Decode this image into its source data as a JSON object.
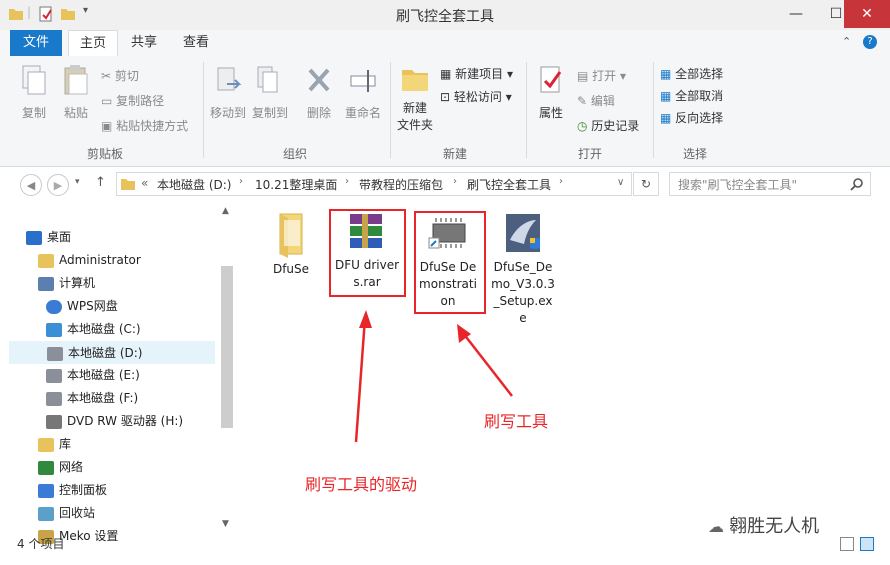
{
  "window": {
    "title": "刷飞控全套工具",
    "minimize": "—",
    "maximize": "☐",
    "close": "✕"
  },
  "tabs": [
    {
      "label": "文件"
    },
    {
      "label": "主页"
    },
    {
      "label": "共享"
    },
    {
      "label": "查看"
    }
  ],
  "ribbon": {
    "clipboard": {
      "group_label": "剪贴板",
      "copy": "复制",
      "paste": "粘贴",
      "cut": "剪切",
      "copy_path": "复制路径",
      "paste_shortcut": "粘贴快捷方式"
    },
    "organize": {
      "group_label": "组织",
      "move_to": "移动到",
      "copy_to": "复制到",
      "delete": "删除",
      "rename": "重命名"
    },
    "new": {
      "group_label": "新建",
      "new_folder_line1": "新建",
      "new_folder_line2": "文件夹",
      "new_item": "新建项目",
      "easy_access": "轻松访问"
    },
    "open": {
      "group_label": "打开",
      "properties": "属性",
      "open": "打开",
      "edit": "编辑",
      "history": "历史记录"
    },
    "select": {
      "group_label": "选择",
      "select_all": "全部选择",
      "select_none": "全部取消",
      "invert": "反向选择"
    }
  },
  "address": {
    "prefix": "«",
    "crumbs": [
      "本地磁盘 (D:)",
      "10.21整理桌面",
      "带教程的压缩包",
      "刷飞控全套工具"
    ],
    "search_placeholder": "搜索\"刷飞控全套工具\""
  },
  "nav": [
    {
      "label": "桌面",
      "icon": "desktop-icon",
      "indent": 0
    },
    {
      "label": "Administrator",
      "icon": "user-folder-icon",
      "indent": 1
    },
    {
      "label": "计算机",
      "icon": "computer-icon",
      "indent": 1
    },
    {
      "label": "WPS网盘",
      "icon": "cloud-icon",
      "indent": 2
    },
    {
      "label": "本地磁盘 (C:)",
      "icon": "windows-drive-icon",
      "indent": 2
    },
    {
      "label": "本地磁盘 (D:)",
      "icon": "drive-icon",
      "indent": 2,
      "selected": true
    },
    {
      "label": "本地磁盘 (E:)",
      "icon": "drive-icon",
      "indent": 2
    },
    {
      "label": "本地磁盘 (F:)",
      "icon": "drive-icon",
      "indent": 2
    },
    {
      "label": "DVD RW 驱动器 (H:)",
      "icon": "dvd-icon",
      "indent": 2
    },
    {
      "label": "库",
      "icon": "library-icon",
      "indent": 1
    },
    {
      "label": "网络",
      "icon": "network-icon",
      "indent": 1
    },
    {
      "label": "控制面板",
      "icon": "control-panel-icon",
      "indent": 1
    },
    {
      "label": "回收站",
      "icon": "recycle-bin-icon",
      "indent": 1
    },
    {
      "label": "Meko 设置",
      "icon": "settings-icon",
      "indent": 1
    }
  ],
  "files": [
    {
      "name": "DfuSe",
      "icon": "folder-icon"
    },
    {
      "name": "DFU drivers.rar",
      "icon": "winrar-archive-icon"
    },
    {
      "name": "DfuSe Demonstration",
      "icon": "chip-shortcut-icon"
    },
    {
      "name": "DfuSe_Demo_V3.0.3_Setup.exe",
      "icon": "installer-icon"
    }
  ],
  "annotations": {
    "tool": "刷写工具",
    "driver": "刷写工具的驱动"
  },
  "status": {
    "count": "4 个项目"
  },
  "watermark": "翱胜无人机",
  "colors": {
    "accent": "#1979ca",
    "annotation": "#e8262a",
    "close": "#c7343a"
  }
}
